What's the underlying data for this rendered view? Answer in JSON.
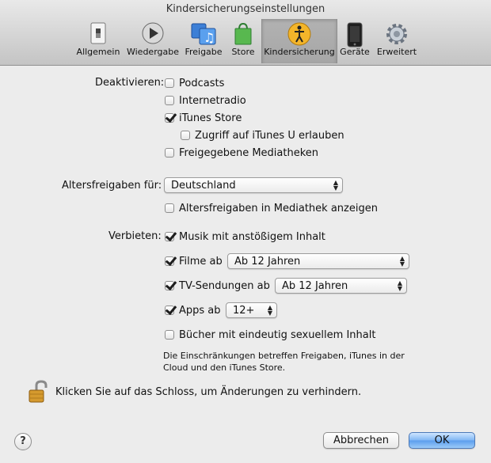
{
  "window": {
    "title": "Kindersicherungseinstellungen"
  },
  "toolbar": {
    "items": [
      {
        "label": "Allgemein",
        "icon": "switch-icon"
      },
      {
        "label": "Wiedergabe",
        "icon": "play-icon"
      },
      {
        "label": "Freigabe",
        "icon": "music-share-icon"
      },
      {
        "label": "Store",
        "icon": "shopping-bag-icon"
      },
      {
        "label": "Kindersicherung",
        "icon": "parental-control-icon",
        "selected": true
      },
      {
        "label": "Geräte",
        "icon": "iphone-icon"
      },
      {
        "label": "Erweitert",
        "icon": "gear-icon"
      }
    ]
  },
  "disable": {
    "label": "Deaktivieren:",
    "podcasts": {
      "label": "Podcasts",
      "checked": false
    },
    "radio": {
      "label": "Internetradio",
      "checked": false
    },
    "itunes_store": {
      "label": "iTunes Store",
      "checked": true
    },
    "itunes_u": {
      "label": "Zugriff auf iTunes U erlauben",
      "checked": false
    },
    "shared": {
      "label": "Freigegebene Mediatheken",
      "checked": false
    }
  },
  "ratings": {
    "label": "Altersfreigaben für:",
    "country": "Deutschland",
    "show_in_library": {
      "label": "Altersfreigaben in Mediathek anzeigen",
      "checked": false
    }
  },
  "restrict": {
    "label": "Verbieten:",
    "music": {
      "label": "Musik mit anstößigem Inhalt",
      "checked": true
    },
    "movies": {
      "label": "Filme ab",
      "checked": true,
      "value": "Ab 12 Jahren"
    },
    "tv": {
      "label": "TV-Sendungen ab",
      "checked": true,
      "value": "Ab 12 Jahren"
    },
    "apps": {
      "label": "Apps ab",
      "checked": true,
      "value": "12+"
    },
    "books": {
      "label": "Bücher mit eindeutig sexuellem Inhalt",
      "checked": false
    },
    "note": "Die Einschränkungen betreffen Freigaben, iTunes in der Cloud und den iTunes Store."
  },
  "lock": {
    "text": "Klicken Sie auf das Schloss, um Änderungen zu verhindern.",
    "icon": "unlocked-padlock-icon"
  },
  "buttons": {
    "help": "?",
    "cancel": "Abbrechen",
    "ok": "OK"
  },
  "colors": {
    "accent": "#5a9ded",
    "window_bg": "#ececec",
    "lock_gold": "#d59a2e"
  }
}
